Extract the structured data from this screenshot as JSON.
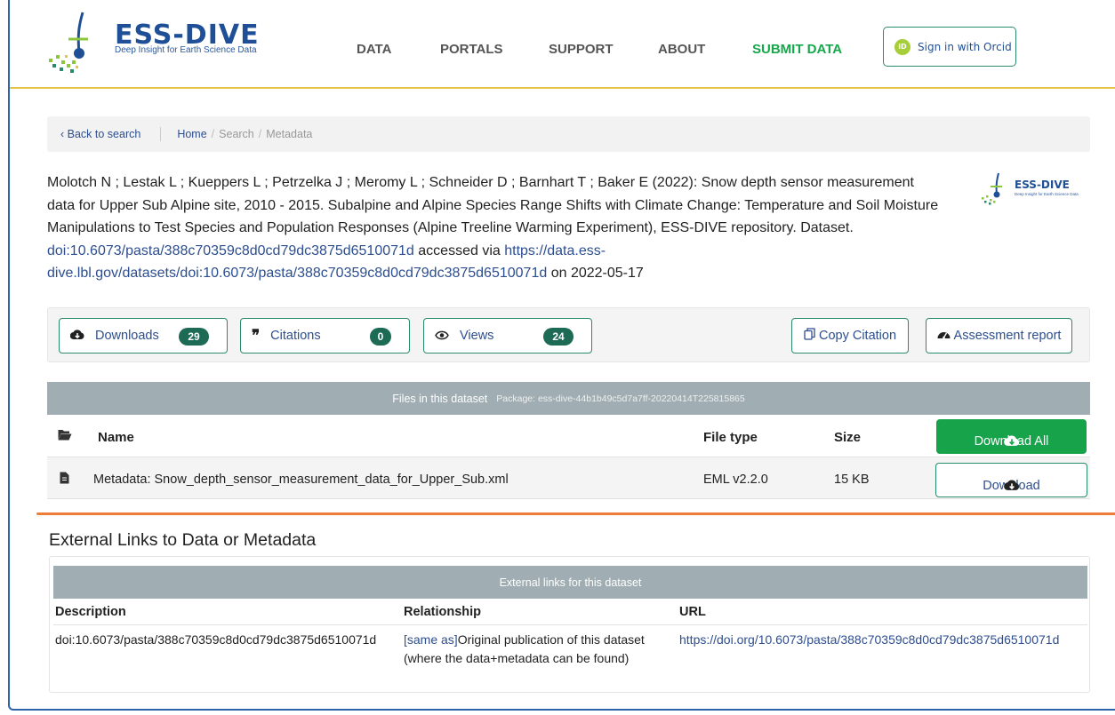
{
  "header": {
    "logo_word": "ESS-DIVE",
    "logo_tagline": "Deep Insight for Earth Science Data",
    "nav": [
      {
        "label": "DATA"
      },
      {
        "label": "PORTALS"
      },
      {
        "label": "SUPPORT"
      },
      {
        "label": "ABOUT"
      },
      {
        "label": "SUBMIT DATA"
      }
    ],
    "signin_label": "Sign in with Orcid",
    "orcid_icon": "iD"
  },
  "breadcrumb": {
    "back": "‹ Back to search",
    "home": "Home",
    "search": "Search",
    "current": "Metadata",
    "separator": "/"
  },
  "citation": {
    "text": "Molotch N ; Lestak L ; Kueppers L ; Petrzelka J ; Meromy L ; Schneider D ; Barnhart T ; Baker E (2022): Snow depth sensor measurement data for Upper Sub Alpine site, 2010 - 2015. Subalpine and Alpine Species Range Shifts with Climate Change: Temperature and Soil Moisture Manipulations to Test Species and Population Responses (Alpine Treeline Warming Experiment), ESS-DIVE repository. Dataset.",
    "doi_link": "doi:10.6073/pasta/388c70359c8d0cd79dc3875d6510071d",
    "accessed_via": "accessed via",
    "url_link": "https://data.ess-dive.lbl.gov/datasets/doi:10.6073/pasta/388c70359c8d0cd79dc3875d6510071d",
    "on_date": "on 2022-05-17"
  },
  "metrics": {
    "downloads_label": "Downloads",
    "downloads_count": "29",
    "citations_label": "Citations",
    "citations_count": "0",
    "views_label": "Views",
    "views_count": "24",
    "copy_citation": "Copy Citation",
    "assessment": "Assessment report"
  },
  "files": {
    "header": "Files in this dataset",
    "package": "Package: ess-dive-44b1b49c5d7a7ff-20220414T225815865",
    "col_name": "Name",
    "col_type": "File type",
    "col_size": "Size",
    "download_all": "Download All",
    "rows": [
      {
        "name": "Metadata: Snow_depth_sensor_measurement_data_for_Upper_Sub.xml",
        "type": "EML v2.2.0",
        "size": "15 KB",
        "action": "Download"
      }
    ]
  },
  "external": {
    "title": "External Links to Data or Metadata",
    "header": "External links for this dataset",
    "col_description": "Description",
    "col_relationship": "Relationship",
    "col_url": "URL",
    "rows": [
      {
        "description": "doi:10.6073/pasta/388c70359c8d0cd79dc3875d6510071d",
        "relationship_tag": "[same as]",
        "relationship_line1": "Original publication of this dataset",
        "relationship_line2": "(where the data+metadata can be found)",
        "url": "https://doi.org/10.6073/pasta/388c70359c8d0cd79dc3875d6510071d"
      }
    ]
  },
  "colors": {
    "brand_blue": "#1f4f96",
    "green": "#16a34a",
    "orange": "#ec7d3a",
    "header_gray": "#a0adb3"
  }
}
